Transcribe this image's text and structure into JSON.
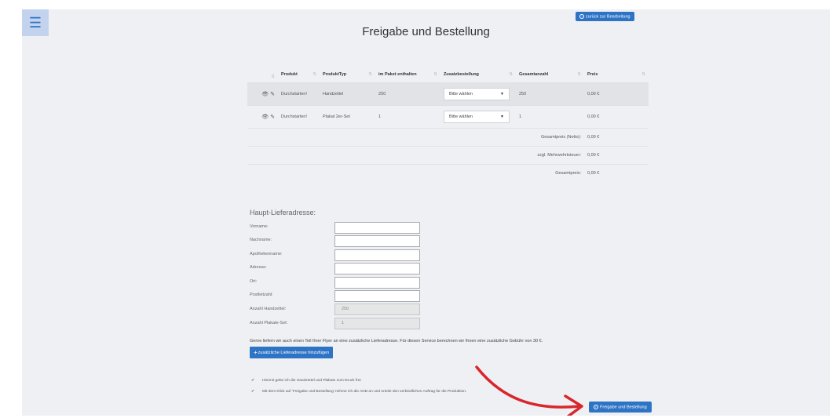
{
  "header": {
    "menu_icon": "hamburger-icon",
    "title": "Freigabe und Bestellung",
    "back_button": "zurück zur Bearbeitung"
  },
  "table": {
    "columns": [
      "Produkt",
      "ProduktTyp",
      "im Paket enthalten",
      "Zusatzbestellung",
      "Gesamtanzahl",
      "Preis"
    ],
    "rows": [
      {
        "produkt": "Durchstarten!",
        "typ": "Handzettel",
        "enthalten": "250",
        "zusatz": "Bitte wählen",
        "gesamt": "250",
        "preis": "0,00 €"
      },
      {
        "produkt": "Durchstarten!",
        "typ": "Plakat 2er-Set",
        "enthalten": "1",
        "zusatz": "Bitte wählen",
        "gesamt": "1",
        "preis": "0,00 €"
      }
    ],
    "summary": [
      {
        "label": "Gesamtpreis (Netto):",
        "value": "0,00 €"
      },
      {
        "label": "zzgl. Mehrwehrtsteuer:",
        "value": "0,00 €"
      },
      {
        "label": "Gesamtpreis:",
        "value": "0,00 €"
      }
    ]
  },
  "address": {
    "title": "Haupt-Lieferadresse:",
    "fields": [
      {
        "label": "Vorname:",
        "value": ""
      },
      {
        "label": "Nachname:",
        "value": ""
      },
      {
        "label": "Apothekenname:",
        "value": ""
      },
      {
        "label": "Adresse:",
        "value": ""
      },
      {
        "label": "Ort:",
        "value": ""
      },
      {
        "label": "Postleitzahl:",
        "value": ""
      },
      {
        "label": "Anzahl Handzettel:",
        "value": "250"
      },
      {
        "label": "Anzahl Plakate-Set:",
        "value": "1"
      }
    ]
  },
  "extra": {
    "note": "Gerne liefern wir auch einen Teil Ihrer Flyer an eine zusätzliche Lieferadresse. Für diesen Service berechnen wir Ihnen eine zusätzliche Gebühr von 30 €.",
    "add_button": "zusätzliche Lieferadresse hinzufügen"
  },
  "consents": [
    "Hiermit gebe ich die Handzettel und Plakate zum Druck frei",
    "Mit dem Klick auf 'Freigabe und Bestellung' nehme ich die AGB an und erteile den verbindlichen Auftrag für die Produktion."
  ],
  "order_button": "Freigabe und Bestellung",
  "colors": {
    "accent": "#2e74c5",
    "annotation_arrow": "#d9262c",
    "page_bg": "#eff0f4"
  }
}
